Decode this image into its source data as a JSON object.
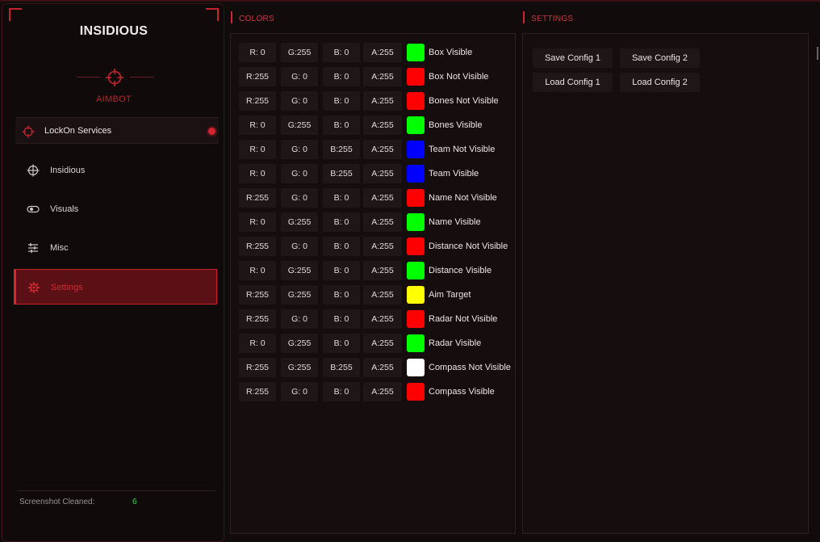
{
  "sidebar": {
    "brand": "INSIDIOUS",
    "section_label": "AIMBOT",
    "service": {
      "label": "LockOn Services",
      "status_color": "#d12430"
    },
    "items": [
      {
        "label": "Insidious",
        "icon": "crosshair-icon",
        "active": false
      },
      {
        "label": "Visuals",
        "icon": "eye-icon",
        "active": false
      },
      {
        "label": "Misc",
        "icon": "sliders-icon",
        "active": false
      },
      {
        "label": "Settings",
        "icon": "gear-icon",
        "active": true
      }
    ],
    "footer": {
      "label": "Screenshot Cleaned:",
      "value": "6"
    }
  },
  "colors_panel": {
    "title": "COLORS",
    "rows": [
      {
        "r": "R:  0",
        "g": "G:255",
        "b": "B:  0",
        "a": "A:255",
        "swatch": "#00ff00",
        "label": "Box Visible"
      },
      {
        "r": "R:255",
        "g": "G:  0",
        "b": "B:  0",
        "a": "A:255",
        "swatch": "#ff0000",
        "label": "Box Not Visible"
      },
      {
        "r": "R:255",
        "g": "G:  0",
        "b": "B:  0",
        "a": "A:255",
        "swatch": "#ff0000",
        "label": "Bones Not Visible"
      },
      {
        "r": "R:  0",
        "g": "G:255",
        "b": "B:  0",
        "a": "A:255",
        "swatch": "#00ff00",
        "label": "Bones Visible"
      },
      {
        "r": "R:  0",
        "g": "G:  0",
        "b": "B:255",
        "a": "A:255",
        "swatch": "#0000ff",
        "label": "Team Not Visible"
      },
      {
        "r": "R:  0",
        "g": "G:  0",
        "b": "B:255",
        "a": "A:255",
        "swatch": "#0000ff",
        "label": "Team Visible"
      },
      {
        "r": "R:255",
        "g": "G:  0",
        "b": "B:  0",
        "a": "A:255",
        "swatch": "#ff0000",
        "label": "Name Not Visible"
      },
      {
        "r": "R:  0",
        "g": "G:255",
        "b": "B:  0",
        "a": "A:255",
        "swatch": "#00ff00",
        "label": "Name Visible"
      },
      {
        "r": "R:255",
        "g": "G:  0",
        "b": "B:  0",
        "a": "A:255",
        "swatch": "#ff0000",
        "label": "Distance Not Visible"
      },
      {
        "r": "R:  0",
        "g": "G:255",
        "b": "B:  0",
        "a": "A:255",
        "swatch": "#00ff00",
        "label": "Distance Visible"
      },
      {
        "r": "R:255",
        "g": "G:255",
        "b": "B:  0",
        "a": "A:255",
        "swatch": "#ffff00",
        "label": "Aim Target"
      },
      {
        "r": "R:255",
        "g": "G:  0",
        "b": "B:  0",
        "a": "A:255",
        "swatch": "#ff0000",
        "label": "Radar Not Visible"
      },
      {
        "r": "R:  0",
        "g": "G:255",
        "b": "B:  0",
        "a": "A:255",
        "swatch": "#00ff00",
        "label": "Radar Visible"
      },
      {
        "r": "R:255",
        "g": "G:255",
        "b": "B:255",
        "a": "A:255",
        "swatch": "#ffffff",
        "label": "Compass Not Visible"
      },
      {
        "r": "R:255",
        "g": "G:  0",
        "b": "B:  0",
        "a": "A:255",
        "swatch": "#ff0000",
        "label": "Compass Visible"
      }
    ]
  },
  "settings_panel": {
    "title": "SETTINGS",
    "buttons": {
      "save1": "Save Config 1",
      "save2": "Save Config 2",
      "load1": "Load Config 1",
      "load2": "Load Config 2"
    }
  },
  "theme": {
    "accent": "#d02530",
    "active_bg": "#5a1014"
  }
}
